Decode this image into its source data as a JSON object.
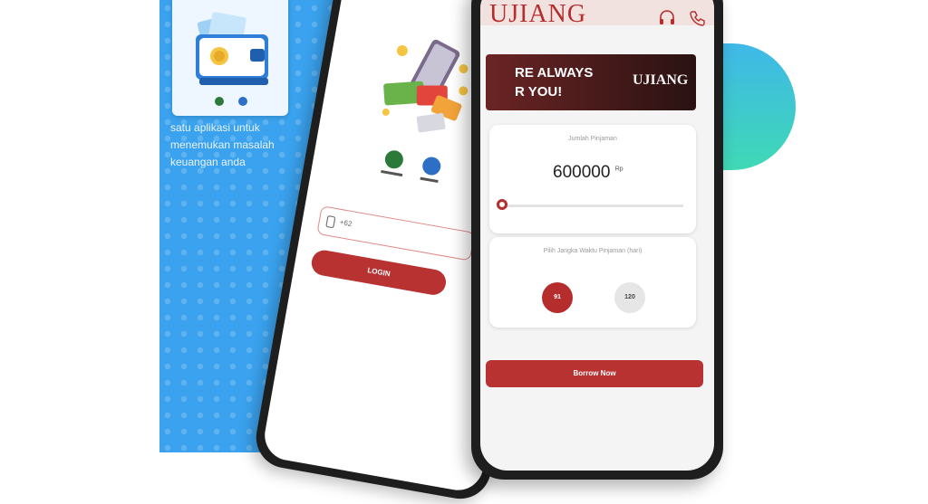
{
  "promo": {
    "lines": [
      "satu aplikasi untuk",
      "menemukan masalah",
      "keuangan anda"
    ]
  },
  "login_screen": {
    "input_placeholder": "+62",
    "login_label": "LOGIN"
  },
  "loan_screen": {
    "brand": "UJIANG",
    "banner_line1": "RE ALWAYS",
    "banner_line2": "R YOU!",
    "banner_logo": "UJIANG",
    "amount_label": "Jumlah Pinjaman",
    "amount_value": "600000",
    "amount_unit": "Rp",
    "amount_fraction": 0.0,
    "term_label": "Pilih Jangka Waktu Pinjaman (hari)",
    "term_options": [
      "91",
      "120"
    ],
    "selected_term": "91",
    "borrow_label": "Borrow Now"
  },
  "colors": {
    "accent": "#b52d2d",
    "promo_blue": "#3aa2ee",
    "teal": "#3fd9b5"
  }
}
